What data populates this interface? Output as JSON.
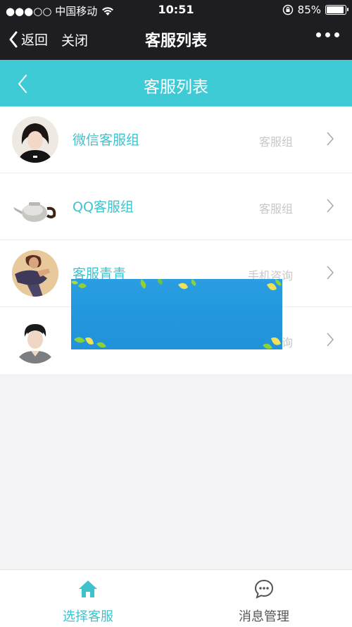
{
  "status_bar": {
    "carrier": "●●●○○ 中国移动",
    "time": "10:51",
    "battery": "85%",
    "battery_level": 0.85
  },
  "wx_nav": {
    "back_label": "返回",
    "close_label": "关闭",
    "title": "客服列表"
  },
  "header": {
    "title": "客服列表"
  },
  "list": {
    "items": [
      {
        "name": "微信客服组",
        "tag": "客服组"
      },
      {
        "name": "QQ客服组",
        "tag": "客服组"
      },
      {
        "name": "客服青青",
        "tag": "手机咨询"
      },
      {
        "name": "",
        "tag": "咨询"
      }
    ]
  },
  "tabs": {
    "select": "选择客服",
    "messages": "消息管理"
  },
  "colors": {
    "accent": "#3ecbd6",
    "dark_bar": "#1e1d21",
    "overlay": "#1c90db"
  }
}
